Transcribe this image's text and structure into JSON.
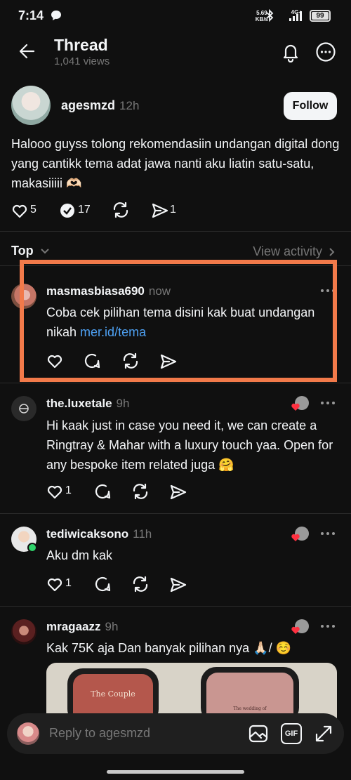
{
  "status_bar": {
    "time": "7:14",
    "net_speed": "5.69",
    "net_unit": "KB/s",
    "network": "4G+",
    "battery": "99"
  },
  "header": {
    "title": "Thread",
    "views": "1,041 views"
  },
  "main_post": {
    "username": "agesmzd",
    "time": "12h",
    "follow_label": "Follow",
    "text": "Halooo guyss tolong rekomendasiin undangan digital dong yang cantikk tema adat jawa nanti aku liatin satu-satu, makasiiiii 🫶🏻",
    "likes": "5",
    "replies": "17",
    "shares": "1"
  },
  "sort": {
    "label": "Top",
    "activity": "View activity"
  },
  "replies": [
    {
      "username": "masmasbiasa690",
      "time": "now",
      "text": "Coba cek pilihan tema disini kak buat undangan nikah ",
      "link": "mer.id/tema",
      "likes": ""
    },
    {
      "username": "the.luxetale",
      "time": "9h",
      "text": "Hi kaak just in case you need it, we can create a Ringtray & Mahar with a luxury touch yaa. Open for any bespoke item related juga 🤗",
      "likes": "1"
    },
    {
      "username": "tediwicaksono",
      "time": "11h",
      "text": "Aku dm kak",
      "likes": "1"
    },
    {
      "username": "mragaazz",
      "time": "9h",
      "text": "Kak 75K aja Dan banyak pilihan nya 🙏🏻/ ☺️",
      "likes": ""
    }
  ],
  "preview_image": {
    "caption_left": "The Couple",
    "caption_right": "The wedding of"
  },
  "reply_bar": {
    "placeholder": "Reply to agesmzd",
    "gif_label": "GIF"
  },
  "colors": {
    "accent_link": "#4ea1f3",
    "highlight_box": "#f27a4a",
    "background": "#101010"
  }
}
